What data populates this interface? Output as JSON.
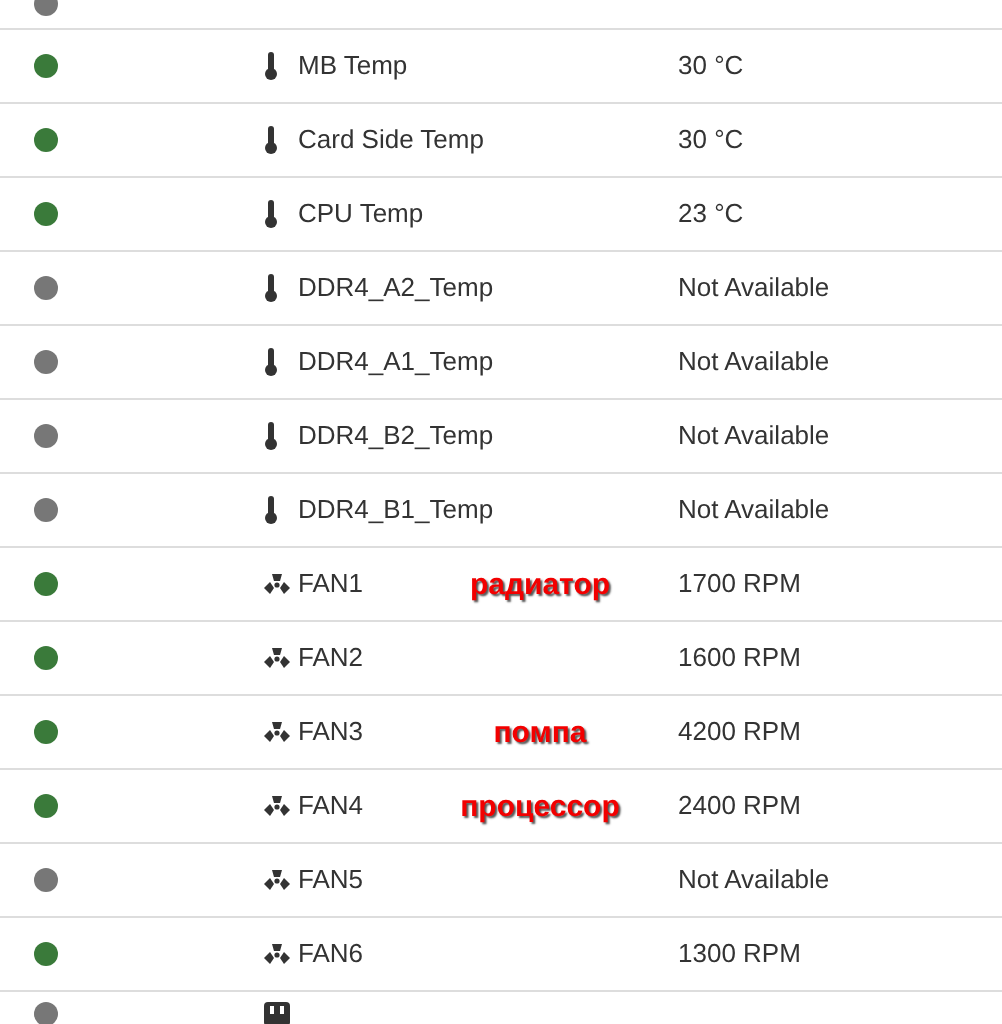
{
  "sensors": [
    {
      "kind": "partial-top",
      "color": "#777777"
    },
    {
      "kind": "temp",
      "color": "#3a7a3a",
      "name": "MB Temp",
      "value": "30 °C"
    },
    {
      "kind": "temp",
      "color": "#3a7a3a",
      "name": "Card Side Temp",
      "value": "30 °C"
    },
    {
      "kind": "temp",
      "color": "#3a7a3a",
      "name": "CPU Temp",
      "value": "23 °C"
    },
    {
      "kind": "temp",
      "color": "#777777",
      "name": "DDR4_A2_Temp",
      "value": "Not Available"
    },
    {
      "kind": "temp",
      "color": "#777777",
      "name": "DDR4_A1_Temp",
      "value": "Not Available"
    },
    {
      "kind": "temp",
      "color": "#777777",
      "name": "DDR4_B2_Temp",
      "value": "Not Available"
    },
    {
      "kind": "temp",
      "color": "#777777",
      "name": "DDR4_B1_Temp",
      "value": "Not Available"
    },
    {
      "kind": "fan",
      "color": "#3a7a3a",
      "name": "FAN1",
      "value": "1700 RPM",
      "note": "радиатор"
    },
    {
      "kind": "fan",
      "color": "#3a7a3a",
      "name": "FAN2",
      "value": "1600 RPM"
    },
    {
      "kind": "fan",
      "color": "#3a7a3a",
      "name": "FAN3",
      "value": "4200 RPM",
      "note": "помпа"
    },
    {
      "kind": "fan",
      "color": "#3a7a3a",
      "name": "FAN4",
      "value": "2400 RPM",
      "note": "процессор"
    },
    {
      "kind": "fan",
      "color": "#777777",
      "name": "FAN5",
      "value": "Not Available"
    },
    {
      "kind": "fan",
      "color": "#3a7a3a",
      "name": "FAN6",
      "value": "1300 RPM"
    },
    {
      "kind": "partial-bottom",
      "color": "#777777"
    }
  ]
}
